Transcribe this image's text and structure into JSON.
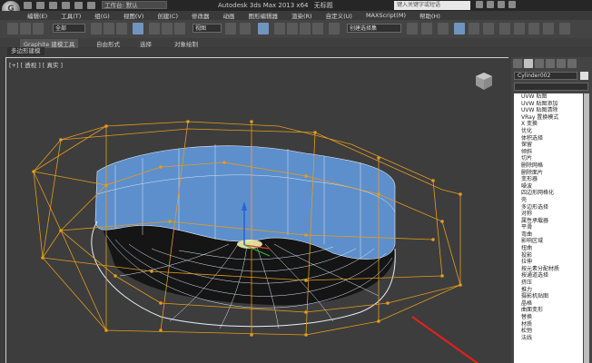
{
  "title": {
    "workspace": "工作台: 默认",
    "app": "Autodesk 3ds Max  2013 x64",
    "document": "无标题",
    "search_placeholder": "键入关键字或短语"
  },
  "menu": [
    "编辑(E)",
    "工具(T)",
    "组(G)",
    "视图(V)",
    "创建(C)",
    "修改器",
    "动画",
    "图形编辑器",
    "渲染(R)",
    "自定义(U)",
    "MAXScript(M)",
    "帮助(H)"
  ],
  "toolbar": {
    "filter_value": "全部",
    "refcoord_value": "视图",
    "named_selection": "创建选择集"
  },
  "ribbon": {
    "tabs": [
      "Graphite 建模工具",
      "自由形式",
      "选择",
      "对象绘制"
    ],
    "subtab": "多边形建模"
  },
  "viewport": {
    "label": "[+] [ 透视 ] [ 真实 ]"
  },
  "panel": {
    "object_name": "Cylinder002",
    "modifiers": [
      "UVW 贴图",
      "UVW 贴图添加",
      "UVW 贴图清除",
      "VRay 置换模式",
      "X 变换",
      "优化",
      "体积选择",
      "保留",
      "倾斜",
      "切片",
      "删除网格",
      "删除面片",
      "变形器",
      "噪波",
      "四边形网格化",
      "壳",
      "多边形选择",
      "对称",
      "属性承载器",
      "平滑",
      "弯曲",
      "影响区域",
      "扭曲",
      "投影",
      "拉伸",
      "按元素分配材质",
      "按通道选择",
      "挤压",
      "推力",
      "摄影机贴图",
      "晶格",
      "曲面变形",
      "替换",
      "材质",
      "松弛",
      "法线"
    ]
  },
  "colors": {
    "lattice": "#e59c1c",
    "mesh_blue": "#5d8fcc",
    "viewport_bg": "#3d3d3d",
    "annotation_arrow": "#e0201d"
  },
  "icons": [
    "app-logo-icon",
    "undo-icon",
    "redo-icon",
    "link-icon",
    "select-icon",
    "move-icon",
    "rotate-icon",
    "scale-icon",
    "snap-icon",
    "mirror-icon",
    "align-icon",
    "render-icon",
    "viewcube-icon"
  ]
}
